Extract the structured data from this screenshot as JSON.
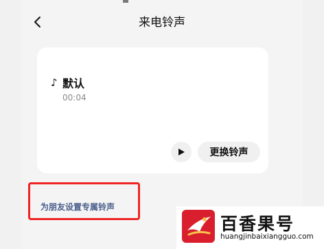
{
  "header": {
    "title": "来电铃声"
  },
  "current_ringtone": {
    "name": "默认",
    "duration": "00:04",
    "note_symbol": "♪"
  },
  "actions": {
    "change_label": "更换铃声"
  },
  "friend_setting": {
    "label": "为朋友设置专属铃声"
  },
  "watermark": {
    "brand": "百香果号",
    "url": "huangjinbaixiangguo.com"
  },
  "colors": {
    "accent_text": "#4a5f8c",
    "highlight_box": "#ef2323",
    "logo_bg": "#d91f2d"
  }
}
